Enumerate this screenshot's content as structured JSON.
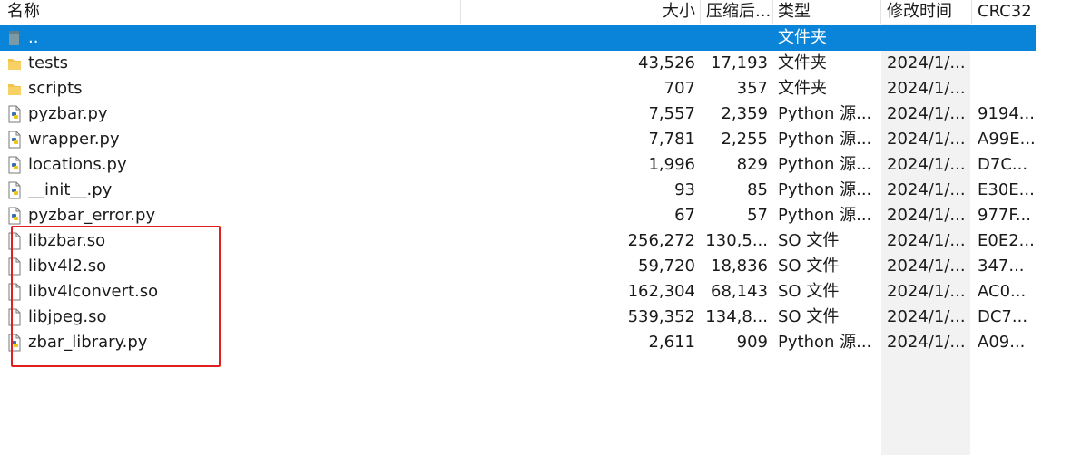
{
  "columns": {
    "name": "名称",
    "size": "大小",
    "packed": "压缩后...",
    "type": "类型",
    "modified": "修改时间",
    "crc": "CRC32"
  },
  "rows": [
    {
      "icon": "folder-up-icon",
      "name": "..",
      "size": "",
      "packed": "",
      "type": "文件夹",
      "modified": "",
      "crc": ""
    },
    {
      "icon": "folder-icon",
      "name": "tests",
      "size": "43,526",
      "packed": "17,193",
      "type": "文件夹",
      "modified": "2024/1/...",
      "crc": ""
    },
    {
      "icon": "folder-icon",
      "name": "scripts",
      "size": "707",
      "packed": "357",
      "type": "文件夹",
      "modified": "2024/1/...",
      "crc": ""
    },
    {
      "icon": "python-file-icon",
      "name": "pyzbar.py",
      "size": "7,557",
      "packed": "2,359",
      "type": "Python 源...",
      "modified": "2024/1/...",
      "crc": "9194..."
    },
    {
      "icon": "python-file-icon",
      "name": "wrapper.py",
      "size": "7,781",
      "packed": "2,255",
      "type": "Python 源...",
      "modified": "2024/1/...",
      "crc": "A99E..."
    },
    {
      "icon": "python-file-icon",
      "name": "locations.py",
      "size": "1,996",
      "packed": "829",
      "type": "Python 源...",
      "modified": "2024/1/...",
      "crc": "D7C..."
    },
    {
      "icon": "python-file-icon",
      "name": "__init__.py",
      "size": "93",
      "packed": "85",
      "type": "Python 源...",
      "modified": "2024/1/...",
      "crc": "E30E..."
    },
    {
      "icon": "python-file-icon",
      "name": "pyzbar_error.py",
      "size": "67",
      "packed": "57",
      "type": "Python 源...",
      "modified": "2024/1/...",
      "crc": "977F..."
    },
    {
      "icon": "blank-file-icon",
      "name": "libzbar.so",
      "size": "256,272",
      "packed": "130,5...",
      "type": "SO 文件",
      "modified": "2024/1/...",
      "crc": "E0E2..."
    },
    {
      "icon": "blank-file-icon",
      "name": "libv4l2.so",
      "size": "59,720",
      "packed": "18,836",
      "type": "SO 文件",
      "modified": "2024/1/...",
      "crc": "347..."
    },
    {
      "icon": "blank-file-icon",
      "name": "libv4lconvert.so",
      "size": "162,304",
      "packed": "68,143",
      "type": "SO 文件",
      "modified": "2024/1/...",
      "crc": "AC0..."
    },
    {
      "icon": "blank-file-icon",
      "name": "libjpeg.so",
      "size": "539,352",
      "packed": "134,8...",
      "type": "SO 文件",
      "modified": "2024/1/...",
      "crc": "DC7..."
    },
    {
      "icon": "python-file-icon",
      "name": "zbar_library.py",
      "size": "2,611",
      "packed": "909",
      "type": "Python 源...",
      "modified": "2024/1/...",
      "crc": "A09..."
    }
  ],
  "selected_row": 0,
  "colors": {
    "selection": "#0a84d8",
    "highlight_box": "#e02020",
    "folder": "#f5c542"
  }
}
